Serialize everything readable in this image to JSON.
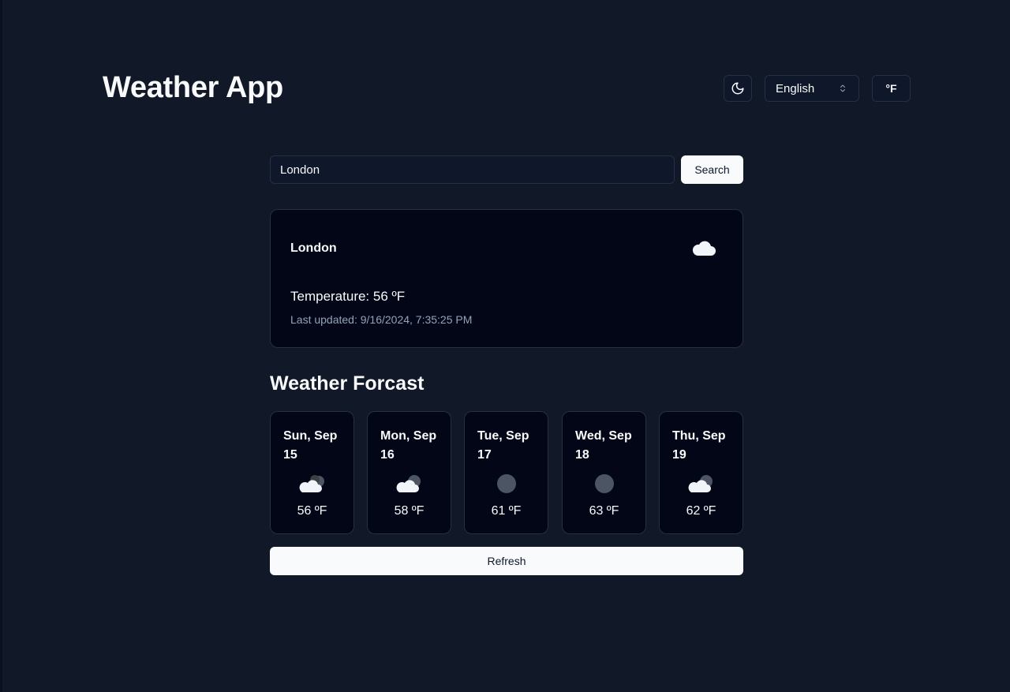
{
  "header": {
    "title": "Weather App",
    "theme_icon": "moon-icon",
    "language": "English",
    "unit_toggle": "°F"
  },
  "search": {
    "value": "London",
    "button_label": "Search"
  },
  "current": {
    "city": "London",
    "icon": "cloud-icon",
    "temperature": "Temperature: 56 ºF",
    "last_updated": "Last updated: 9/16/2024, 7:35:25 PM"
  },
  "forecast": {
    "title": "Weather Forcast",
    "days": [
      {
        "date": "Sun, Sep 15",
        "icon": "cloudy-night-icon",
        "temp": "56 ºF"
      },
      {
        "date": "Mon, Sep 16",
        "icon": "partly-cloudy-night-icon",
        "temp": "58 ºF"
      },
      {
        "date": "Tue, Sep 17",
        "icon": "clear-night-icon",
        "temp": "61 ºF"
      },
      {
        "date": "Wed, Sep 18",
        "icon": "clear-night-icon",
        "temp": "63 ºF"
      },
      {
        "date": "Thu, Sep 19",
        "icon": "partly-cloudy-night-icon",
        "temp": "62 ºF"
      }
    ]
  },
  "refresh_label": "Refresh",
  "colors": {
    "background": "#111827",
    "card": "#020617",
    "border": "#263043",
    "text": "#f8fafc",
    "muted": "#94a3b8",
    "button": "#f8fafc"
  }
}
